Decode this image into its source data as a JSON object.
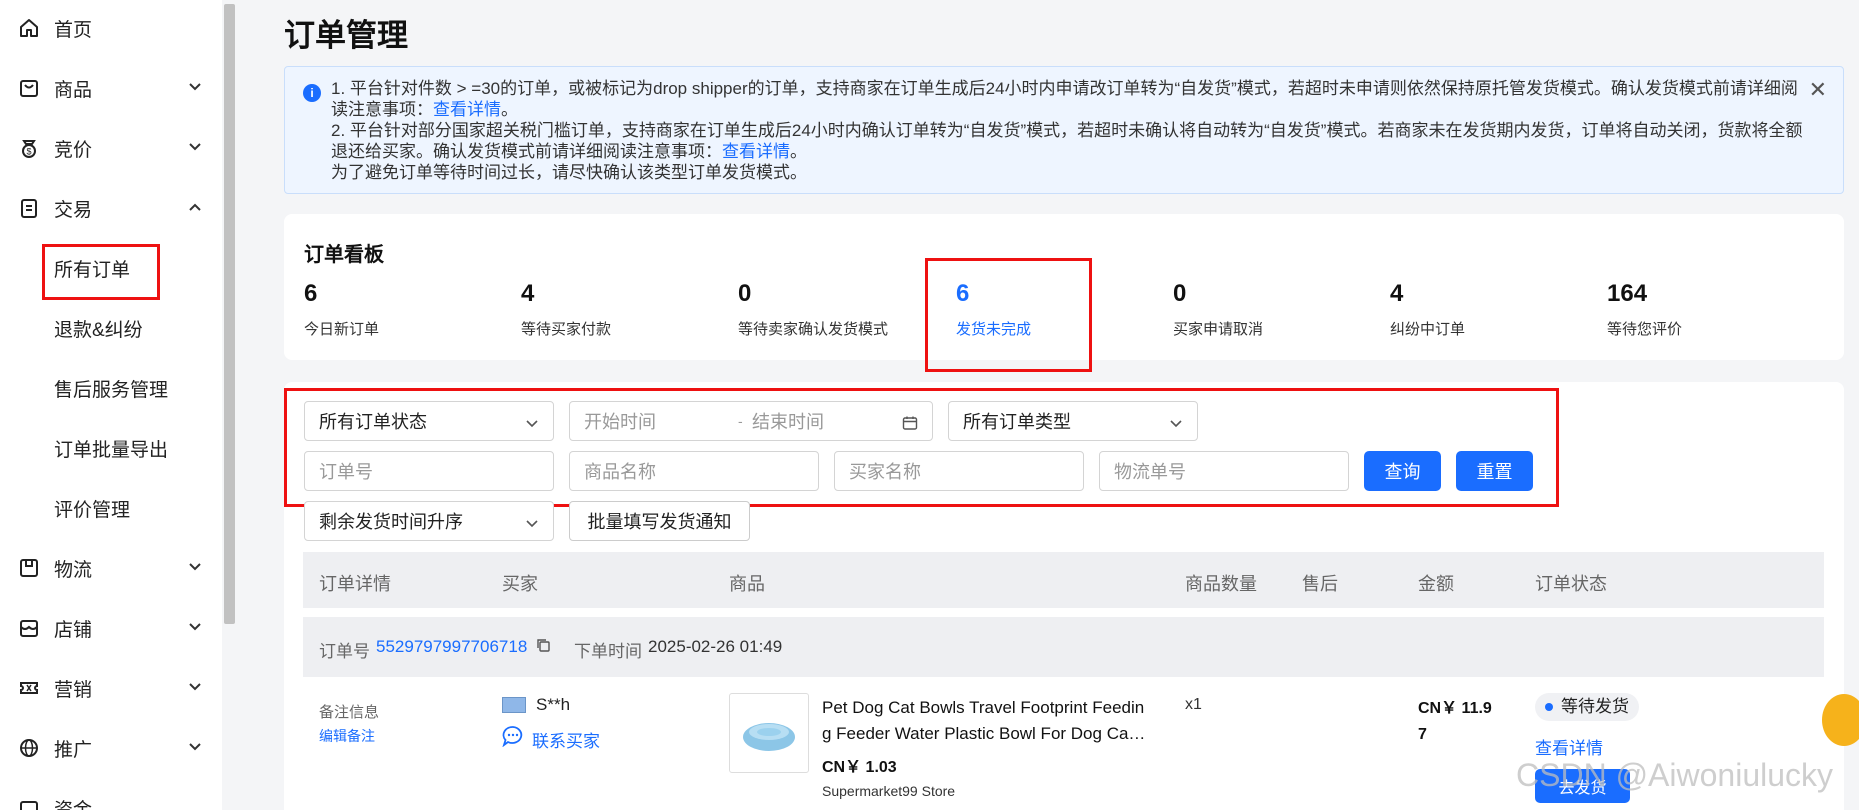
{
  "sidebar": {
    "items": [
      {
        "label": "首页",
        "icon": "home-icon"
      },
      {
        "label": "商品",
        "icon": "bag-icon"
      },
      {
        "label": "竞价",
        "icon": "bidding-icon"
      },
      {
        "label": "交易",
        "icon": "clipboard-icon"
      },
      {
        "label": "物流",
        "icon": "logistics-icon"
      },
      {
        "label": "店铺",
        "icon": "store-icon"
      },
      {
        "label": "营销",
        "icon": "ticket-icon"
      },
      {
        "label": "推广",
        "icon": "globe-icon"
      },
      {
        "label": "资金",
        "icon": "wallet-icon"
      }
    ],
    "trade_sub": [
      "所有订单",
      "退款&纠纷",
      "售后服务管理",
      "订单批量导出",
      "评价管理"
    ]
  },
  "page": {
    "title": "订单管理"
  },
  "notice": {
    "line1_pre": "1. 平台针对件数 > =30的订单，或被标记为drop shipper的订单，支持商家在订单生成后24小时内申请改订单转为“自发货”模式，若超时未申请则依然保持原托管发货模式。确认发货模式前请详细阅读注意事项：",
    "line2_pre": "2. 平台针对部分国家超关税门槛订单，支持商家在订单生成后24小时内确认订单转为“自发货”模式，若超时未确认将自动转为“自发货”模式。若商家未在发货期内发货，订单将自动关闭，货款将全额退还给买家。确认发货模式前请详细阅读注意事项：",
    "link": "查看详情",
    "period": "。",
    "line3": "为了避免订单等待时间过长，请尽快确认该类型订单发货模式。",
    "close": "✕"
  },
  "board": {
    "title": "订单看板",
    "stats": [
      {
        "value": "6",
        "label": "今日新订单"
      },
      {
        "value": "4",
        "label": "等待买家付款"
      },
      {
        "value": "0",
        "label": "等待卖家确认发货模式"
      },
      {
        "value": "6",
        "label": "发货未完成"
      },
      {
        "value": "0",
        "label": "买家申请取消"
      },
      {
        "value": "4",
        "label": "纠纷中订单"
      },
      {
        "value": "164",
        "label": "等待您评价"
      }
    ]
  },
  "filters": {
    "status_select": "所有订单状态",
    "start_time": "开始时间",
    "dash": "-",
    "end_time": "结束时间",
    "type_select": "所有订单类型",
    "order_no": "订单号",
    "product_name": "商品名称",
    "buyer_name": "买家名称",
    "tracking_no": "物流单号",
    "query": "查询",
    "reset": "重置",
    "sort_select": "剩余发货时间升序",
    "batch_notify": "批量填写发货通知"
  },
  "table": {
    "headers": [
      "订单详情",
      "买家",
      "商品",
      "商品数量",
      "售后",
      "金额",
      "订单状态"
    ]
  },
  "order": {
    "id_label": "订单号",
    "id": "5529797997706718",
    "time_label": "下单时间",
    "time": "2025-02-26 01:49",
    "note_label": "备注信息",
    "note_edit": "编辑备注",
    "buyer": "S**h",
    "contact": "联系买家",
    "product_title_1": "Pet Dog Cat Bowls Travel Footprint Feedin",
    "product_title_2": "g Feeder Water Plastic Bowl For Dog Ca…",
    "unit_price": "CN￥ 1.03",
    "store": "Supermarket99 Store",
    "qty": "x1",
    "amount_1": "CN￥ 11.9",
    "amount_2": "7",
    "status": "等待发货",
    "detail": "查看详情",
    "ship": "去发货"
  },
  "watermark": "CSDN @Aiwoniulucky"
}
